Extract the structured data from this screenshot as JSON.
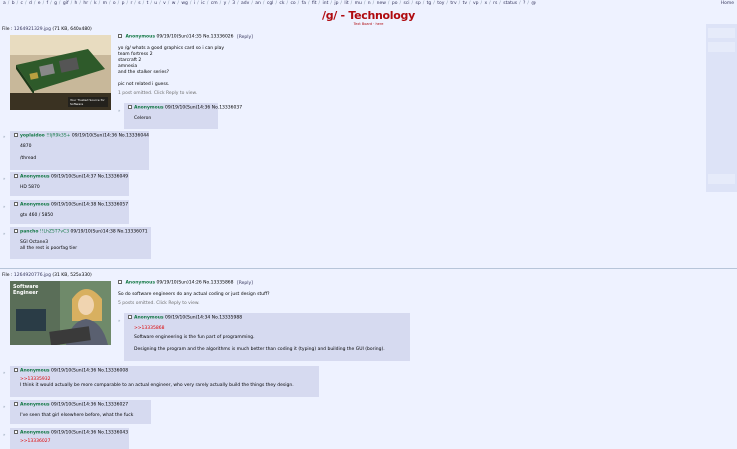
{
  "topbar": {
    "boards": [
      "a",
      "b",
      "c",
      "d",
      "e",
      "f",
      "g",
      "gif",
      "h",
      "hr",
      "k",
      "m",
      "o",
      "p",
      "r",
      "s",
      "t",
      "u",
      "v",
      "w",
      "wg",
      "i",
      "ic",
      "cm",
      "y",
      "3",
      "adv",
      "an",
      "cgl",
      "ck",
      "co",
      "fa",
      "fit",
      "int",
      "jp",
      "lit",
      "mu",
      "n",
      "new",
      "po",
      "sci",
      "sp",
      "tg",
      "toy",
      "trv",
      "tv",
      "vp",
      "x",
      "rs",
      "status",
      "?",
      "@"
    ],
    "home": "Home"
  },
  "header": {
    "title": "/g/ - Technology",
    "subtitle": "Text Board · here"
  },
  "threads": [
    {
      "file": {
        "label": "File :",
        "name": "1264921329.jpg",
        "meta": "(71 KB, 640x480)"
      },
      "thumb_caption": "Your Trusted Source for Software",
      "op": {
        "name": "Anonymous",
        "datetime": "09/19/10(Sun)14:35",
        "no": "No.13336026",
        "reply": "[Reply]",
        "lines": [
          "yo /g/ whats a good graphics card so i can play",
          "team fortress 2",
          "starcraft 2",
          "amnesia",
          "and the stalker series?",
          "",
          "pic not related i guess."
        ],
        "omitted": "1 post omitted. Click Reply to view."
      },
      "replies": [
        {
          "name": "Anonymous",
          "trip": "",
          "datetime": "09/19/10(Sun)14:36",
          "no": "No.13336037",
          "quote": "",
          "lines": [
            "Celeron"
          ]
        },
        {
          "name": "yoplaidoo",
          "trip": "!!ljR9k3S+",
          "datetime": "09/19/10(Sun)14:36",
          "no": "No.13336044",
          "quote": "",
          "lines": [
            "4870",
            "",
            "/thread"
          ]
        },
        {
          "name": "Anonymous",
          "trip": "",
          "datetime": "09/19/10(Sun)14:37",
          "no": "No.13336049",
          "quote": "",
          "lines": [
            "HD 5870"
          ]
        },
        {
          "name": "Anonymous",
          "trip": "",
          "datetime": "09/19/10(Sun)14:38",
          "no": "No.13336057",
          "quote": "",
          "lines": [
            "gtx 460 / 5850"
          ]
        },
        {
          "name": "pancho",
          "trip": "!!LhZ5T7vC3",
          "datetime": "09/19/10(Sun)14:38",
          "no": "No.13336071",
          "quote": "",
          "lines": [
            "SGI Octane3",
            "all the rest is poorfag tier"
          ]
        }
      ]
    },
    {
      "file": {
        "label": "File :",
        "name": "1264920776.jpg",
        "meta": "(31 KB, 525x330)"
      },
      "thumb_caption": "Software Engineer",
      "op": {
        "name": "Anonymous",
        "datetime": "09/19/10(Sun)14:26",
        "no": "No.13335868",
        "reply": "[Reply]",
        "lines": [
          "So do software engineers do any actual coding or just design stuff?"
        ],
        "omitted": "5 posts omitted. Click Reply to view."
      },
      "replies": [
        {
          "name": "Anonymous",
          "trip": "",
          "datetime": "09/19/10(Sun)14:34",
          "no": "No.13335988",
          "quote": ">>13335868",
          "lines": [
            "Software engineering is the fun part of programming.",
            "",
            "Designing the program and the algorithms is much better than coding it (typing) and building the GUI (boring)."
          ]
        },
        {
          "name": "Anonymous",
          "trip": "",
          "datetime": "09/19/10(Sun)14:36",
          "no": "No.13336008",
          "quote": ">>13335932",
          "lines": [
            "I think it would actually be more comparable to an actual engineer, who very rarely actually build the things they design."
          ]
        },
        {
          "name": "Anonymous",
          "trip": "",
          "datetime": "09/19/10(Sun)14:36",
          "no": "No.13336027",
          "quote": "",
          "lines": [
            "I've seen that girl elsewhere before, what the fuck"
          ]
        },
        {
          "name": "Anonymous",
          "trip": "",
          "datetime": "09/19/10(Sun)14:36",
          "no": "No.13336043",
          "quote": ">>13336027",
          "lines": [
            ""
          ]
        }
      ]
    }
  ]
}
